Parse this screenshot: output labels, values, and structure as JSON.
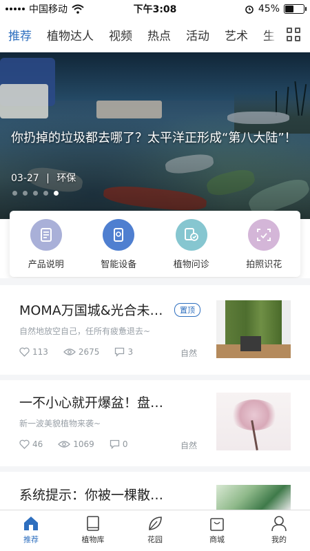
{
  "status_bar": {
    "carrier": "中国移动",
    "time": "下午3:08",
    "battery_text": "45%",
    "battery_level": 0.45
  },
  "tabs": [
    {
      "label": "推荐",
      "active": true
    },
    {
      "label": "植物达人",
      "active": false
    },
    {
      "label": "视频",
      "active": false
    },
    {
      "label": "热点",
      "active": false
    },
    {
      "label": "活动",
      "active": false
    },
    {
      "label": "艺术",
      "active": false
    },
    {
      "label": "生",
      "active": false
    }
  ],
  "banner": {
    "title": "你扔掉的垃圾都去哪了？太平洋正形成“第八大陆”！",
    "date": "03-27",
    "separator": "|",
    "category": "环保",
    "dot_count": 5,
    "active_dot": 4
  },
  "quick_actions": [
    {
      "label": "产品说明",
      "icon": "manual-icon",
      "color": "#a9b0d8"
    },
    {
      "label": "智能设备",
      "icon": "device-icon",
      "color": "#4f7fd0"
    },
    {
      "label": "植物问诊",
      "icon": "diagnosis-icon",
      "color": "#86c6d0"
    },
    {
      "label": "拍照识花",
      "icon": "camera-scan-icon",
      "color": "#d4b6d8"
    }
  ],
  "articles": [
    {
      "title": "MOMA万国城&光合未…",
      "subtitle": "自然地放空自己，任所有疲惫退去~",
      "likes": "113",
      "views": "2675",
      "comments": "3",
      "tag": "自然",
      "pinned_label": "置顶"
    },
    {
      "title": "一不小心就开爆盆！盘…",
      "subtitle": "新一波美貌植物来袭~",
      "likes": "46",
      "views": "1069",
      "comments": "0",
      "tag": "自然"
    },
    {
      "title": "系统提示：你被一棵散…",
      "subtitle": "",
      "likes": "",
      "views": "",
      "comments": "",
      "tag": ""
    }
  ],
  "bottom_nav": [
    {
      "label": "推荐",
      "icon": "home-icon",
      "active": true
    },
    {
      "label": "植物库",
      "icon": "book-icon",
      "active": false
    },
    {
      "label": "花园",
      "icon": "leaf-icon",
      "active": false
    },
    {
      "label": "商城",
      "icon": "shopping-bag-icon",
      "active": false
    },
    {
      "label": "我的",
      "icon": "profile-icon",
      "active": false
    }
  ],
  "colors": {
    "accent": "#2e6fbf",
    "text": "#222222",
    "muted": "#9aa1a8"
  }
}
